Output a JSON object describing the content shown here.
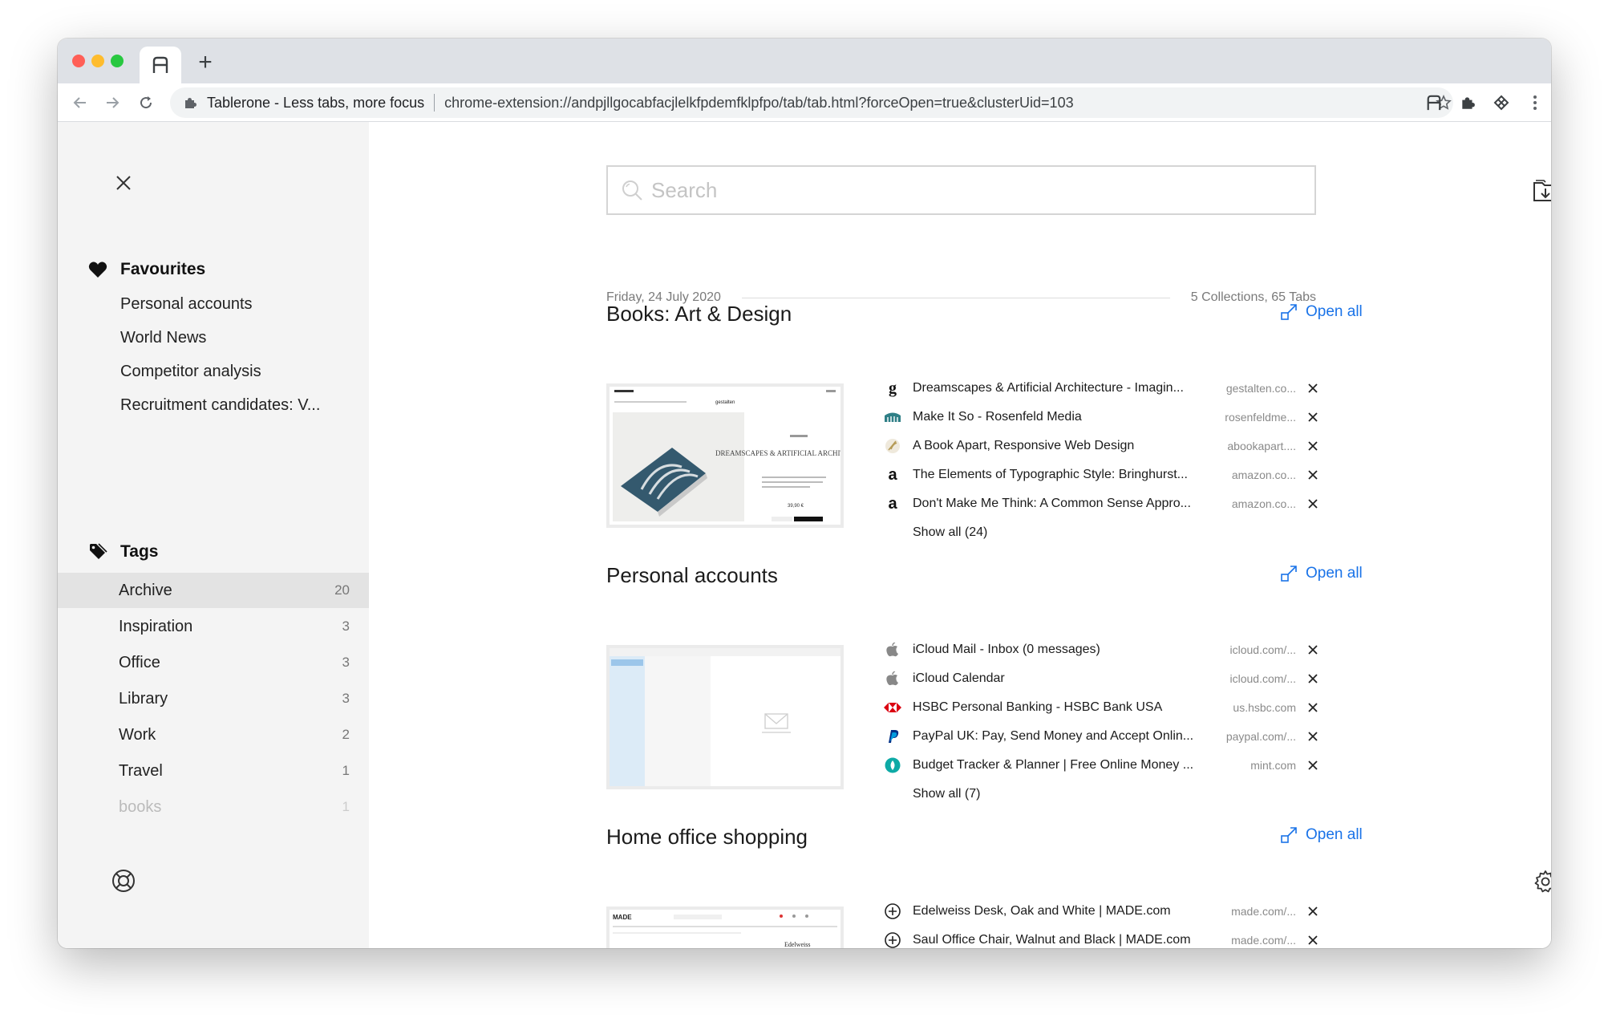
{
  "browser": {
    "page_title": "Tablerone - Less tabs, more focus",
    "url": "chrome-extension://andpjllgocabfacjlelkfpdemfklpfpo/tab/tab.html?forceOpen=true&clusterUid=103",
    "new_tab_label": "+"
  },
  "sidebar": {
    "favourites_heading": "Favourites",
    "favourites": [
      "Personal accounts",
      "World News",
      "Competitor analysis",
      "Recruitment candidates: V..."
    ],
    "tags_heading": "Tags",
    "tags": [
      {
        "name": "Archive",
        "count": "20"
      },
      {
        "name": "Inspiration",
        "count": "3"
      },
      {
        "name": "Office",
        "count": "3"
      },
      {
        "name": "Library",
        "count": "3"
      },
      {
        "name": "Work",
        "count": "2"
      },
      {
        "name": "Travel",
        "count": "1"
      },
      {
        "name": "books",
        "count": "1"
      }
    ]
  },
  "main": {
    "search_placeholder": "Search",
    "date": "Friday, 24 July 2020",
    "summary": "5 Collections, 65 Tabs",
    "collections": [
      {
        "title": "Books: Art & Design",
        "open_all": "Open all",
        "show_all": "Show all (24)",
        "thumb": {
          "brand": "gestalten",
          "heading": "DREAMSCAPES & ARTIFICIAL ARCHITECTURE",
          "price": "39,90 €"
        },
        "tabs": [
          {
            "title": "Dreamscapes & Artificial Architecture - Imagin...",
            "domain": "gestalten.co...",
            "favicon": "g"
          },
          {
            "title": "Make It So - Rosenfeld Media",
            "domain": "rosenfeldme...",
            "favicon": "rosenfeld"
          },
          {
            "title": "A Book Apart, Responsive Web Design",
            "domain": "abookapart....",
            "favicon": "abookapart"
          },
          {
            "title": "The Elements of Typographic Style: Bringhurst...",
            "domain": "amazon.co...",
            "favicon": "a"
          },
          {
            "title": "Don't Make Me Think: A Common Sense Appro...",
            "domain": "amazon.co...",
            "favicon": "a"
          }
        ]
      },
      {
        "title": "Personal accounts",
        "open_all": "Open all",
        "show_all": "Show all (7)",
        "tabs": [
          {
            "title": "iCloud Mail - Inbox (0 messages)",
            "domain": "icloud.com/...",
            "favicon": "apple"
          },
          {
            "title": "iCloud Calendar",
            "domain": "icloud.com/...",
            "favicon": "apple"
          },
          {
            "title": "HSBC Personal Banking - HSBC Bank USA",
            "domain": "us.hsbc.com",
            "favicon": "hsbc"
          },
          {
            "title": "PayPal UK: Pay, Send Money and Accept Onlin...",
            "domain": "paypal.com/...",
            "favicon": "paypal"
          },
          {
            "title": "Budget Tracker & Planner | Free Online Money ...",
            "domain": "mint.com",
            "favicon": "mint"
          }
        ]
      },
      {
        "title": "Home office shopping",
        "open_all": "Open all",
        "thumb": {
          "brand": "MADE",
          "heading": "Edelweiss"
        },
        "tabs": [
          {
            "title": "Edelweiss Desk, Oak and White | MADE.com",
            "domain": "made.com/...",
            "favicon": "plus"
          },
          {
            "title": "Saul Office Chair, Walnut and Black | MADE.com",
            "domain": "made.com/...",
            "favicon": "plus"
          }
        ]
      }
    ]
  }
}
